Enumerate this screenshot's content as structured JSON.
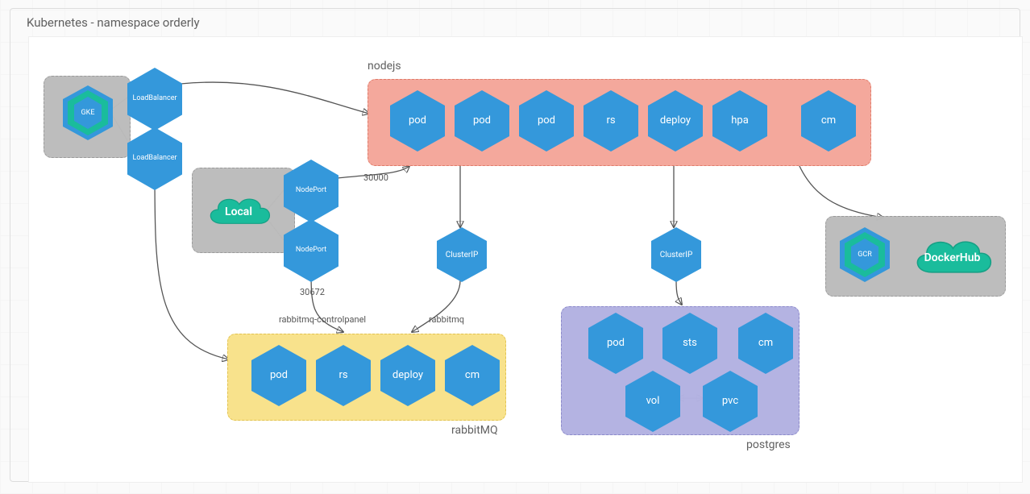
{
  "title": "Kubernetes - namespace orderly",
  "groups": {
    "gke_group": {
      "kind": "gray"
    },
    "local_group": {
      "kind": "gray"
    },
    "registry_group": {
      "kind": "gray"
    },
    "nodejs": {
      "label": "nodejs",
      "kind": "pink"
    },
    "rabbitmq": {
      "label": "rabbitMQ",
      "kind": "yellow"
    },
    "postgres": {
      "label": "postgres",
      "kind": "purple"
    }
  },
  "nodes": {
    "gke": "GKE",
    "gcr": "GCR",
    "local": "Local",
    "dockerhub": "DockerHub",
    "lb1": "LoadBalancer",
    "lb2": "LoadBalancer",
    "np1": "NodePort",
    "np2": "NodePort",
    "cip1": "ClusterIP",
    "cip2": "ClusterIP",
    "nodejs_items": [
      "pod",
      "pod",
      "pod",
      "rs",
      "deploy",
      "hpa",
      "cm"
    ],
    "rabbit_items": [
      "pod",
      "rs",
      "deploy",
      "cm"
    ],
    "pg_row1": [
      "pod",
      "sts",
      "cm"
    ],
    "pg_row2": [
      "vol",
      "pvc"
    ]
  },
  "edges": {
    "port_30000": "30000",
    "port_30672": "30672",
    "rabbit_cp": "rabbitmq-controlpanel",
    "rabbit": "rabbitmq"
  }
}
